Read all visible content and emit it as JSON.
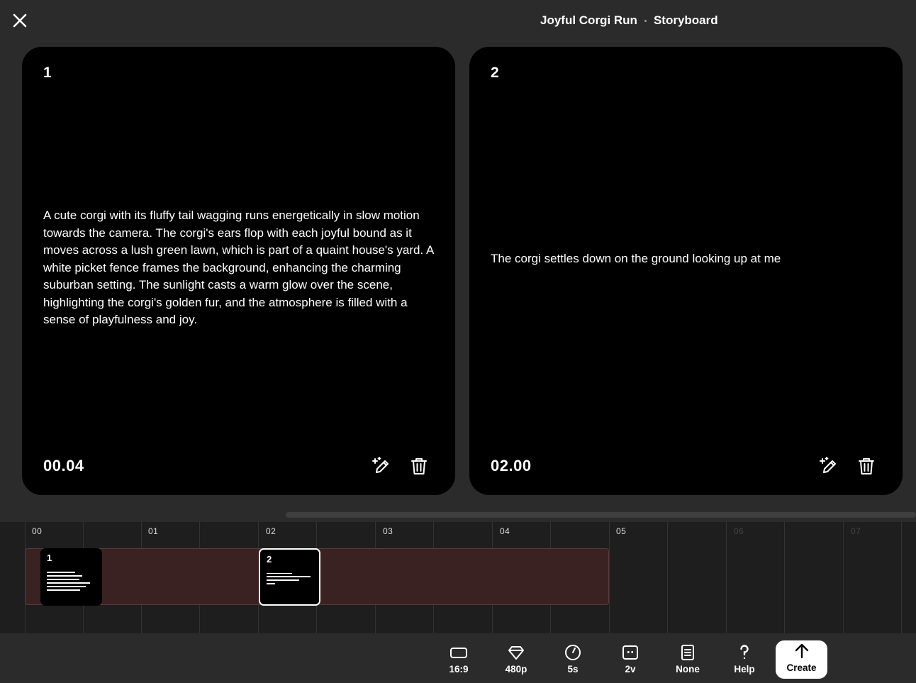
{
  "header": {
    "project_title": "Joyful Corgi Run",
    "view_label": "Storyboard"
  },
  "icons": {
    "close": "close-icon",
    "edit": "magic-pencil-icon",
    "delete": "trash-icon",
    "aspect": "aspect-ratio-icon",
    "quality": "diamond-icon",
    "duration": "clock-icon",
    "variations": "variations-icon",
    "preset": "document-icon",
    "help": "question-icon",
    "create": "arrow-up-icon"
  },
  "cards": [
    {
      "number": "1",
      "description": "A cute corgi with its fluffy tail wagging runs energetically in slow motion towards the camera. The corgi's ears flop with each joyful bound as it moves across a lush green lawn, which is part of a quaint house's yard. A white picket fence frames the background, enhancing the charming suburban setting. The sunlight casts a warm glow over the scene, highlighting the corgi's golden fur, and the atmosphere is filled with a sense of playfulness and joy.",
      "timestamp": "00.04"
    },
    {
      "number": "2",
      "description": "The corgi settles down on the ground looking up at me",
      "timestamp": "02.00"
    }
  ],
  "timeline": {
    "labels": [
      "00",
      "01",
      "02",
      "03",
      "04",
      "05",
      "06",
      "07"
    ],
    "total_seconds": 5,
    "clips": [
      {
        "number": "1",
        "start_seconds": 0.04,
        "selected": false
      },
      {
        "number": "2",
        "start_seconds": 2.0,
        "selected": true
      }
    ],
    "track_color": "#3a2222"
  },
  "toolbar": {
    "aspect_ratio": "16:9",
    "resolution": "480p",
    "duration": "5s",
    "variations": "2v",
    "preset": "None",
    "help": "Help",
    "create": "Create"
  }
}
